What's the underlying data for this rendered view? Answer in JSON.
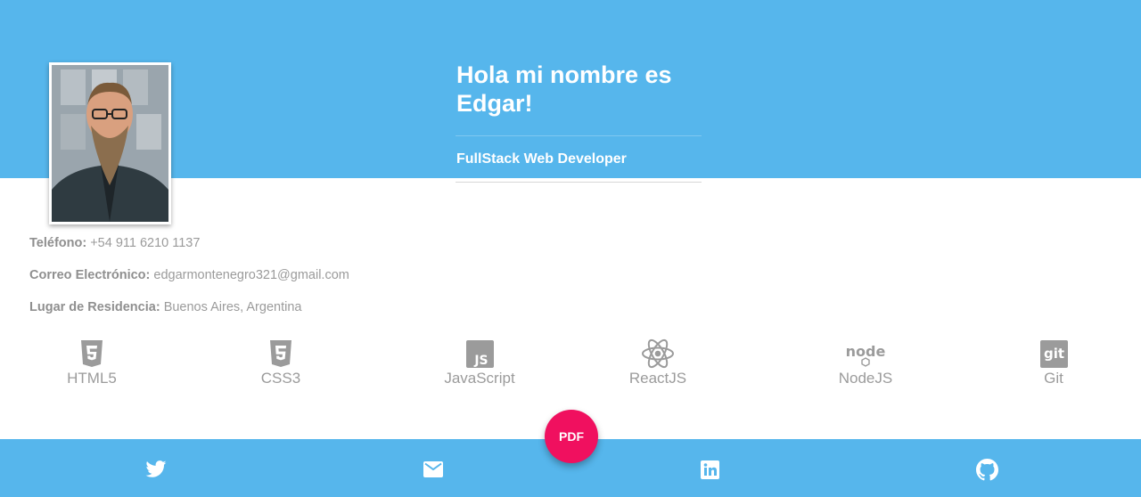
{
  "header": {
    "greeting": "Hola mi nombre es Edgar!",
    "role": "FullStack Web Developer",
    "avatar_alt": "profile-photo"
  },
  "contact": {
    "phone_label": "Teléfono:",
    "phone_value": "+54 911 6210 1137",
    "email_label": "Correo Electrónico:",
    "email_value": "edgarmontenegro321@gmail.com",
    "residence_label": "Lugar de Residencia:",
    "residence_value": "Buenos Aires, Argentina"
  },
  "skills": [
    {
      "label": "HTML5",
      "icon": "html5-icon"
    },
    {
      "label": "CSS3",
      "icon": "css3-icon"
    },
    {
      "label": "JavaScript",
      "icon": "javascript-icon"
    },
    {
      "label": "ReactJS",
      "icon": "react-icon"
    },
    {
      "label": "NodeJS",
      "icon": "nodejs-icon"
    },
    {
      "label": "Git",
      "icon": "git-icon"
    }
  ],
  "fab": {
    "label": "PDF"
  },
  "footer": {
    "links": [
      "twitter-icon",
      "email-icon",
      "linkedin-icon",
      "github-icon"
    ]
  },
  "colors": {
    "hero": "#56b6ec",
    "fab": "#f0105f",
    "muted_text": "#9b9b9b"
  }
}
